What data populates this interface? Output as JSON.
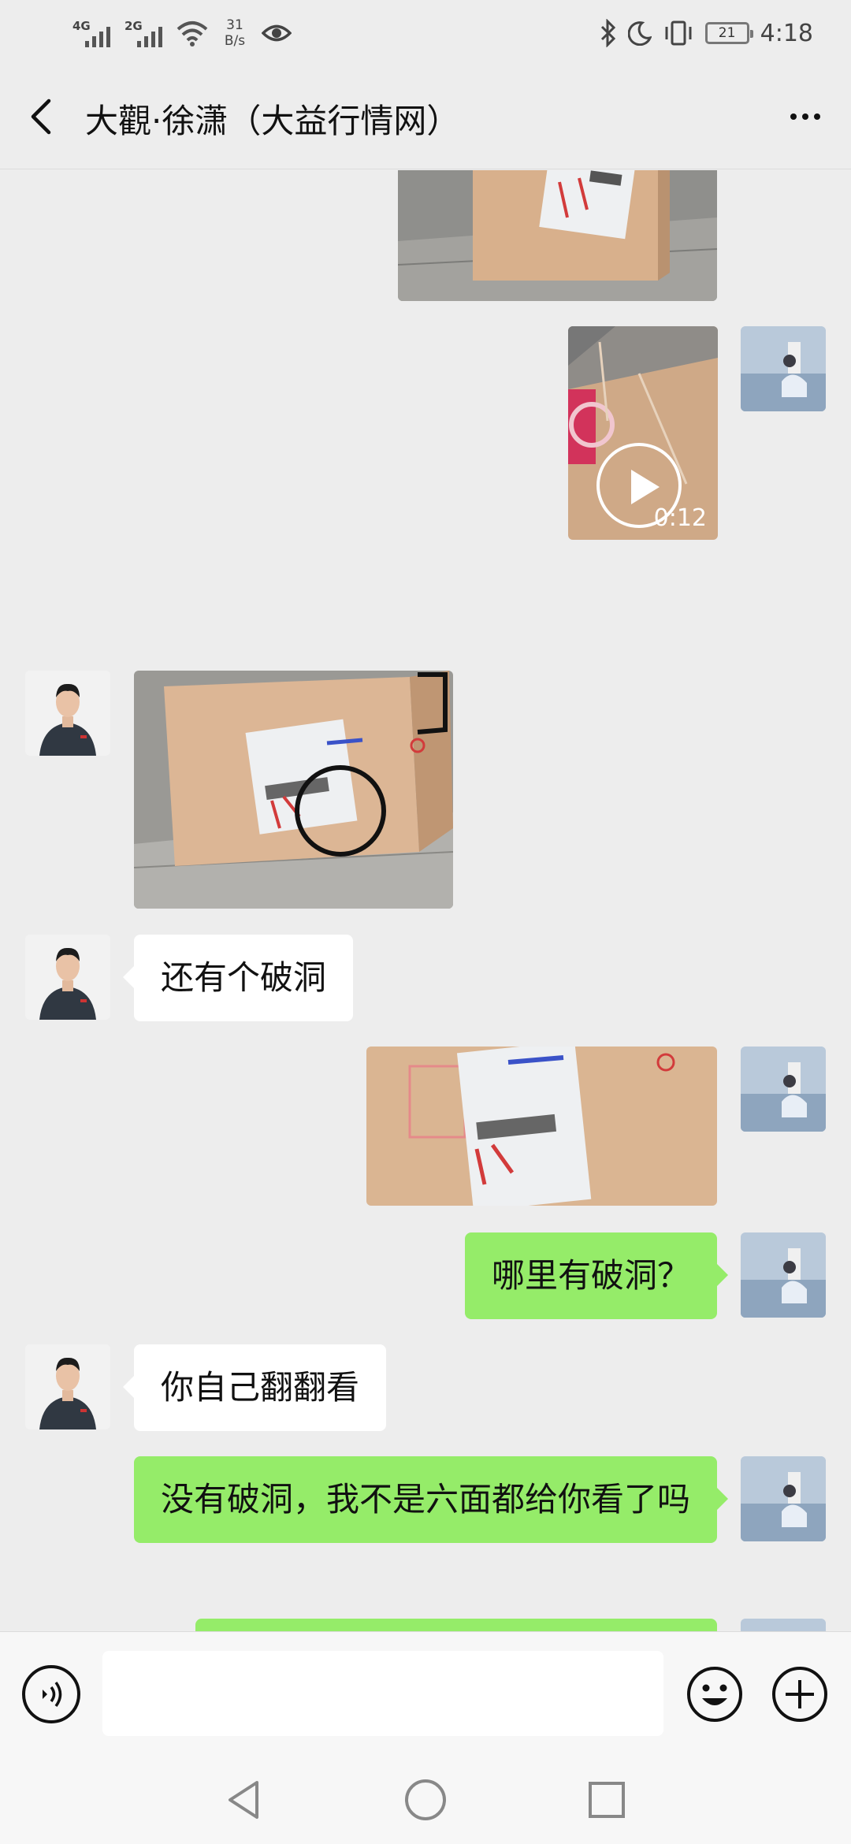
{
  "status_bar": {
    "network_1": "4G",
    "network_2": "2G",
    "speed_value": "31",
    "speed_unit": "B/s",
    "battery": "21",
    "time": "4:18"
  },
  "header": {
    "title": "大觀·徐潇（大益行情网）"
  },
  "messages": {
    "video_duration": "0:12",
    "text_1": "还有个破洞",
    "text_2": "哪里有破洞？",
    "text_3": "你自己翻翻看",
    "text_4": "没有破洞，我不是六面都给你看了吗"
  },
  "input": {
    "placeholder": ""
  },
  "colors": {
    "outgoing_bubble": "#95ec69",
    "incoming_bubble": "#ffffff",
    "background": "#ededed"
  }
}
